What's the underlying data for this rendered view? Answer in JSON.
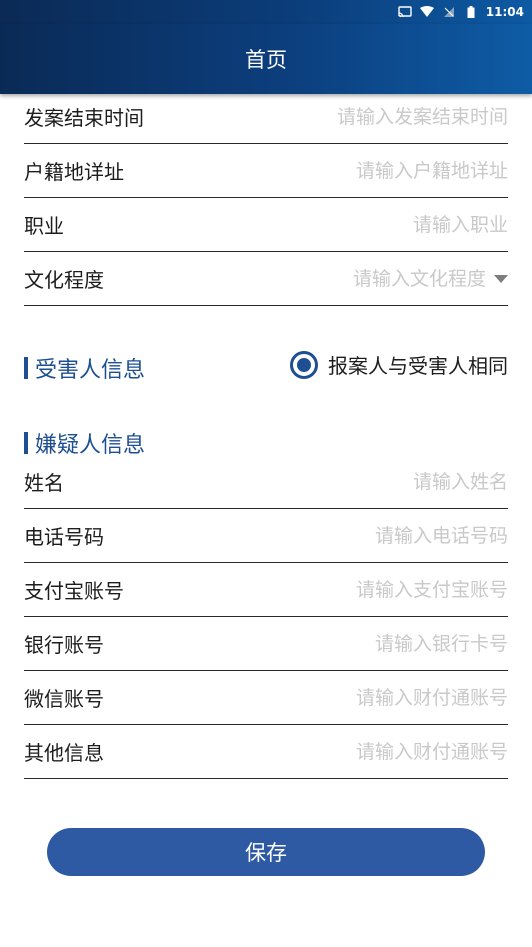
{
  "status_bar": {
    "time": "11:04",
    "icons": [
      "cast-icon",
      "wifi-icon",
      "no-sim-icon",
      "battery-icon"
    ]
  },
  "app_bar": {
    "title": "首页"
  },
  "case_fields": [
    {
      "label": "发案结束时间",
      "placeholder": "请输入发案结束时间",
      "value": ""
    },
    {
      "label": "户籍地详址",
      "placeholder": "请输入户籍地详址",
      "value": ""
    },
    {
      "label": "职业",
      "placeholder": "请输入职业",
      "value": ""
    },
    {
      "label": "文化程度",
      "placeholder": "请输入文化程度",
      "value": "",
      "type": "dropdown"
    }
  ],
  "victim_section": {
    "title": "受害人信息",
    "radio_label": "报案人与受害人相同",
    "radio_checked": true
  },
  "suspect_section": {
    "title": "嫌疑人信息",
    "fields": [
      {
        "label": "姓名",
        "placeholder": "请输入姓名",
        "value": ""
      },
      {
        "label": "电话号码",
        "placeholder": "请输入电话号码",
        "value": ""
      },
      {
        "label": "支付宝账号",
        "placeholder": "请输入支付宝账号",
        "value": ""
      },
      {
        "label": "银行账号",
        "placeholder": "请输入银行卡号",
        "value": ""
      },
      {
        "label": "微信账号",
        "placeholder": "请输入财付通账号",
        "value": ""
      },
      {
        "label": "其他信息",
        "placeholder": "请输入财付通账号",
        "value": ""
      }
    ]
  },
  "save_button": {
    "label": "保存"
  },
  "colors": {
    "header_gradient_start": "#0a2a56",
    "header_gradient_end": "#0e5ca6",
    "accent": "#1e4f92",
    "button": "#2d5aa3",
    "placeholder": "#c9c9c9"
  }
}
